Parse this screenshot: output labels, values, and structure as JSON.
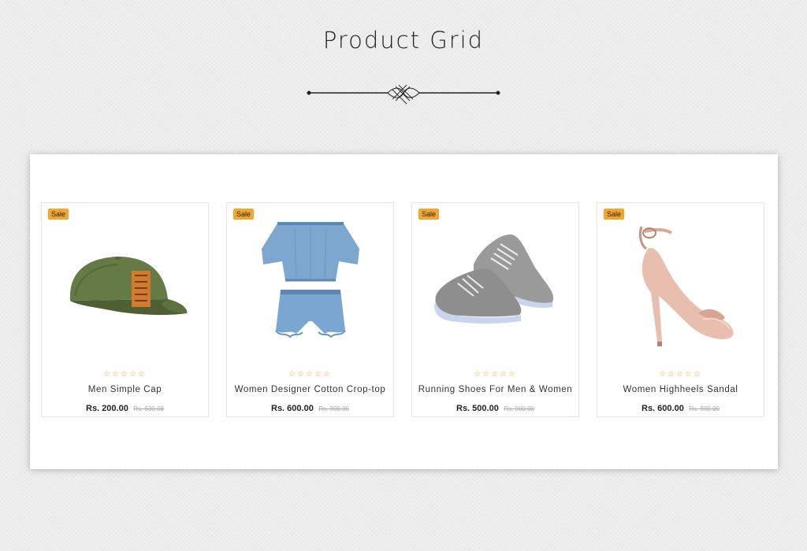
{
  "page": {
    "title": "Product Grid"
  },
  "products": [
    {
      "badge": "Sale",
      "name": "Men Simple Cap",
      "price": "Rs. 200.00",
      "old_price": "Rs. 500.00",
      "rating": "☆☆☆☆☆",
      "icon": "cap-icon"
    },
    {
      "badge": "Sale",
      "name": "Women Designer Cotton Crop-top",
      "price": "Rs. 600.00",
      "old_price": "Rs. 900.00",
      "rating": "☆☆☆☆☆",
      "icon": "crop-top-icon"
    },
    {
      "badge": "Sale",
      "name": "Running Shoes For Men & Women",
      "price": "Rs. 500.00",
      "old_price": "Rs. 900.00",
      "rating": "☆☆☆☆☆",
      "icon": "shoes-icon"
    },
    {
      "badge": "Sale",
      "name": "Women Highheels Sandal",
      "price": "Rs. 600.00",
      "old_price": "Rs. 900.00",
      "rating": "☆☆☆☆☆",
      "icon": "sandal-icon"
    }
  ],
  "colors": {
    "badge": "#f2a62b",
    "stars": "#f0a22b",
    "text": "#222222"
  }
}
